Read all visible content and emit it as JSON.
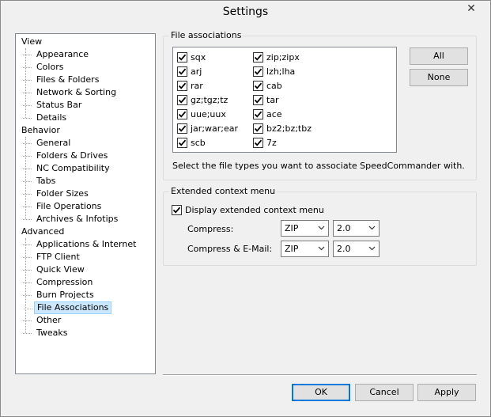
{
  "window": {
    "title": "Settings",
    "close_glyph": "✕"
  },
  "tree": {
    "categories": [
      {
        "label": "View",
        "children": [
          "Appearance",
          "Colors",
          "Files & Folders",
          "Network & Sorting",
          "Status Bar",
          "Details"
        ]
      },
      {
        "label": "Behavior",
        "children": [
          "General",
          "Folders & Drives",
          "NC Compatibility",
          "Tabs",
          "Folder Sizes",
          "File Operations",
          "Archives & Infotips"
        ]
      },
      {
        "label": "Advanced",
        "children": [
          "Applications & Internet",
          "FTP Client",
          "Quick View",
          "Compression",
          "Burn Projects",
          "File Associations",
          "Other",
          "Tweaks"
        ]
      }
    ],
    "selected": "File Associations"
  },
  "file_associations": {
    "group_label": "File associations",
    "left_column": [
      {
        "label": "sqx",
        "checked": true
      },
      {
        "label": "arj",
        "checked": true
      },
      {
        "label": "rar",
        "checked": true
      },
      {
        "label": "gz;tgz;tz",
        "checked": true
      },
      {
        "label": "uue;uux",
        "checked": true
      },
      {
        "label": "jar;war;ear",
        "checked": true
      },
      {
        "label": "scb",
        "checked": true
      }
    ],
    "right_column": [
      {
        "label": "zip;zipx",
        "checked": true
      },
      {
        "label": "lzh;lha",
        "checked": true
      },
      {
        "label": "cab",
        "checked": true
      },
      {
        "label": "tar",
        "checked": true
      },
      {
        "label": "ace",
        "checked": true
      },
      {
        "label": "bz2;bz;tbz",
        "checked": true
      },
      {
        "label": "7z",
        "checked": true
      }
    ],
    "all_button": "All",
    "none_button": "None",
    "description": "Select the file types you want to associate SpeedCommander with."
  },
  "extended_menu": {
    "group_label": "Extended context menu",
    "display_checkbox_label": "Display extended context menu",
    "display_checked": true,
    "compress_label": "Compress:",
    "compress_format": "ZIP",
    "compress_version": "2.0",
    "compress_email_label": "Compress & E-Mail:",
    "compress_email_format": "ZIP",
    "compress_email_version": "2.0"
  },
  "footer": {
    "ok": "OK",
    "cancel": "Cancel",
    "apply": "Apply"
  },
  "icons": {
    "check": "check-icon",
    "dropdown": "chevron-down-icon",
    "close": "close-icon"
  },
  "colors": {
    "selection_bg": "#cce8ff",
    "selection_border": "#99d1ff",
    "default_button_border": "#0078d7",
    "window_bg": "#f0f0f0"
  }
}
